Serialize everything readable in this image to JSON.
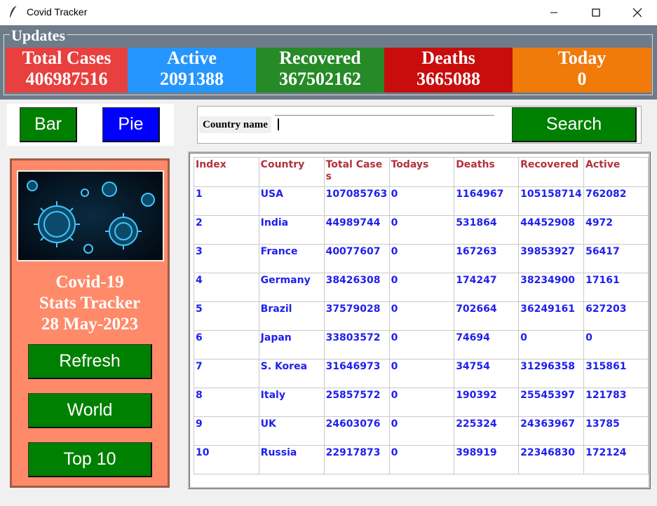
{
  "window": {
    "title": "Covid Tracker"
  },
  "updates": {
    "legend": "Updates",
    "stats": [
      {
        "label": "Total Cases",
        "value": "406987516",
        "color": "#e83f3f"
      },
      {
        "label": "Active",
        "value": "2091388",
        "color": "#2696ff"
      },
      {
        "label": "Recovered",
        "value": "367502162",
        "color": "#268a26"
      },
      {
        "label": "Deaths",
        "value": "3665088",
        "color": "#c90d0d"
      },
      {
        "label": "Today",
        "value": "0",
        "color": "#f07a0a"
      }
    ]
  },
  "chart_buttons": {
    "bar": "Bar",
    "pie": "Pie"
  },
  "search": {
    "label": "Country name",
    "value": "",
    "button": "Search"
  },
  "sidebar": {
    "title_line1": "Covid-19",
    "title_line2": "Stats Tracker",
    "date": "28 May-2023",
    "refresh": "Refresh",
    "world": "World",
    "top10": "Top 10"
  },
  "table": {
    "headers": [
      "Index",
      "Country",
      "Total Cases",
      "Todays",
      "Deaths",
      "Recovered",
      "Active"
    ],
    "rows": [
      [
        "1",
        "USA",
        "107085763",
        "0",
        "1164967",
        "105158714",
        "762082"
      ],
      [
        "2",
        "India",
        "44989744",
        "0",
        "531864",
        "44452908",
        "4972"
      ],
      [
        "3",
        "France",
        "40077607",
        "0",
        "167263",
        "39853927",
        "56417"
      ],
      [
        "4",
        "Germany",
        "38426308",
        "0",
        "174247",
        "38234900",
        "17161"
      ],
      [
        "5",
        "Brazil",
        "37579028",
        "0",
        "702664",
        "36249161",
        "627203"
      ],
      [
        "6",
        "Japan",
        "33803572",
        "0",
        "74694",
        "0",
        "0"
      ],
      [
        "7",
        "S. Korea",
        "31646973",
        "0",
        "34754",
        "31296358",
        "315861"
      ],
      [
        "8",
        "Italy",
        "25857572",
        "0",
        "190392",
        "25545397",
        "121783"
      ],
      [
        "9",
        "UK",
        "24603076",
        "0",
        "225324",
        "24363967",
        "13785"
      ],
      [
        "10",
        "Russia",
        "22917873",
        "0",
        "398919",
        "22346830",
        "172124"
      ]
    ]
  },
  "colors": {
    "green_button": "#008000",
    "blue_button": "#0000ff",
    "panel": "#ff8a6a",
    "header_text": "#b4303a",
    "cell_text": "#2020ee"
  }
}
